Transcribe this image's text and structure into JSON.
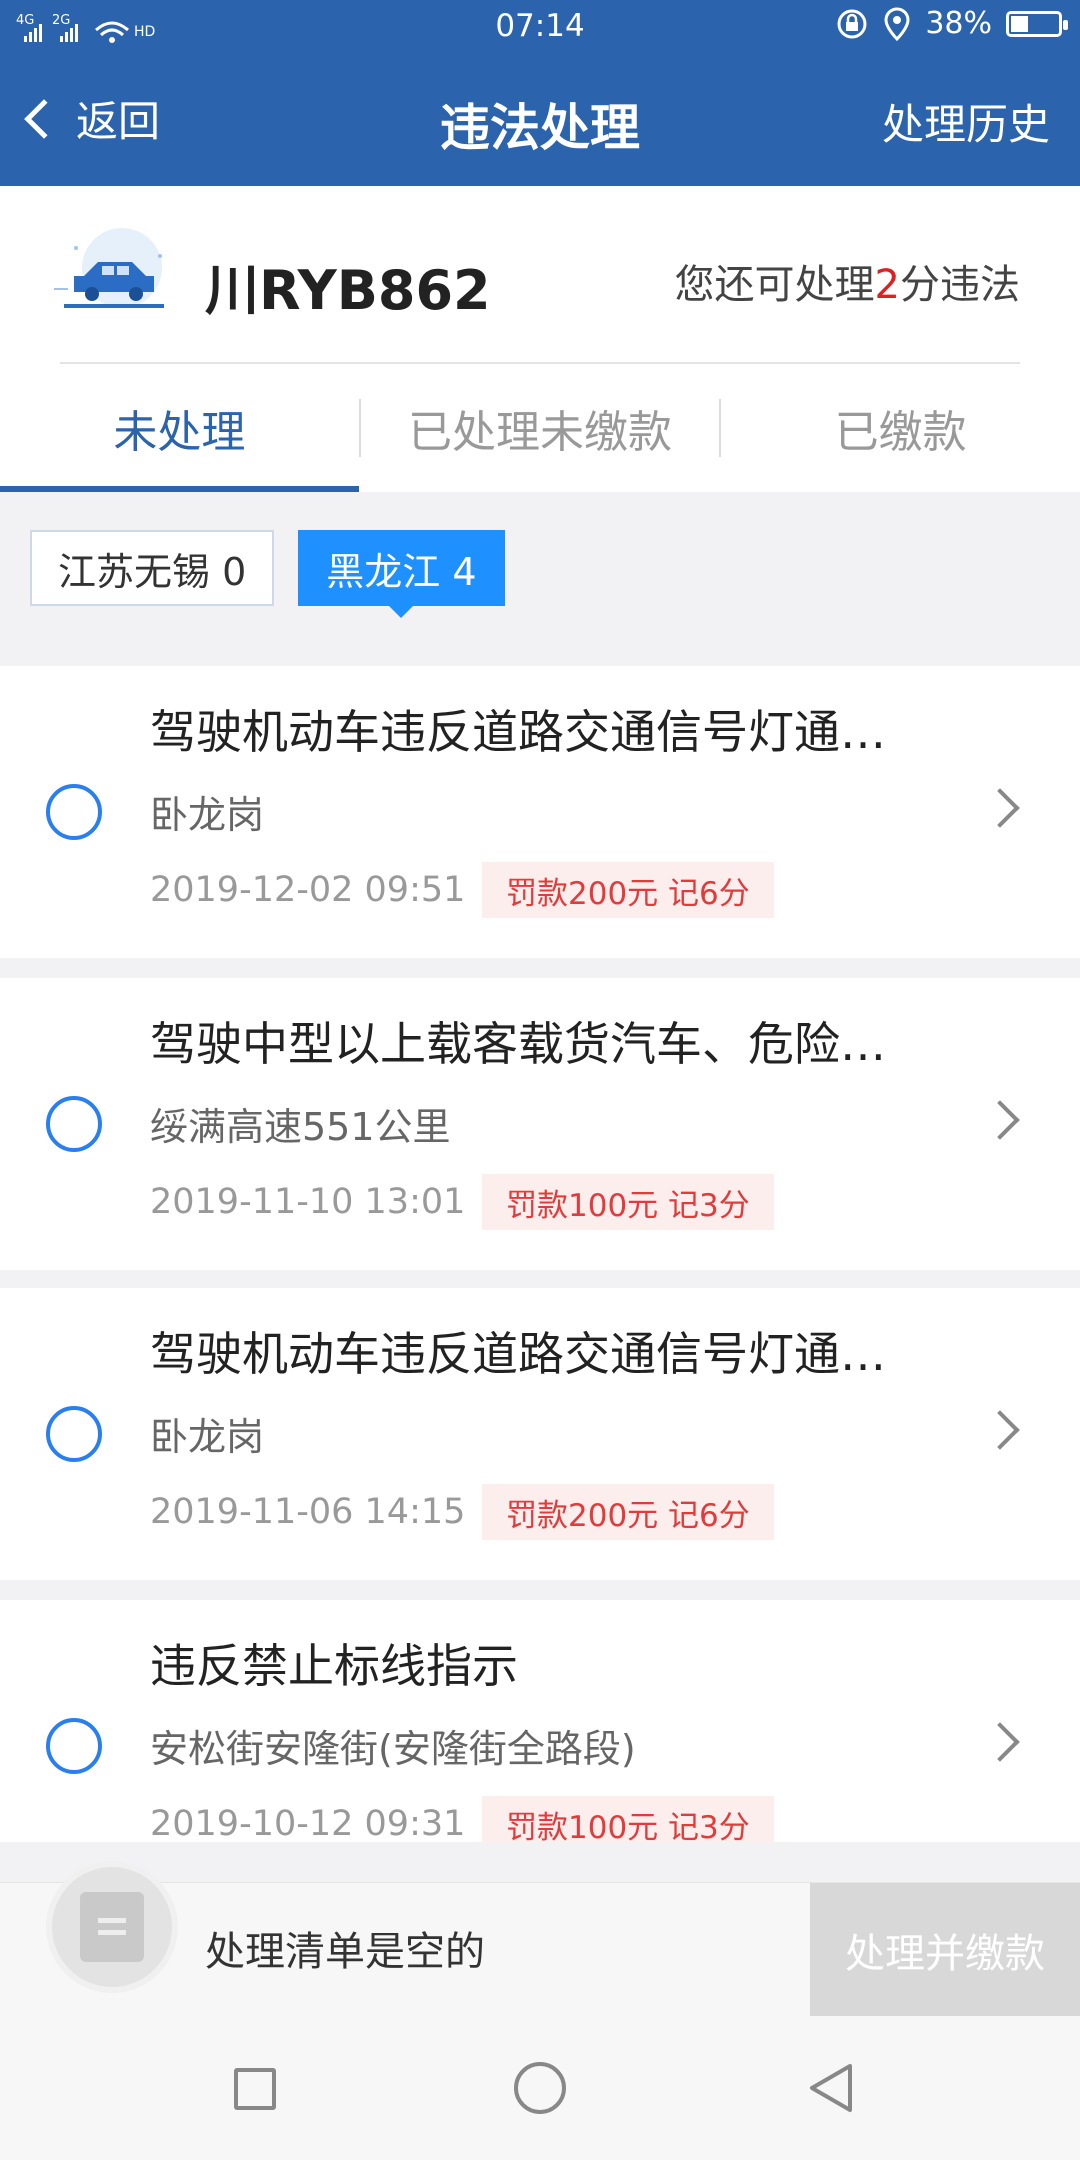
{
  "status_bar": {
    "network": "4G  2G",
    "time": "07:14",
    "battery": "38%",
    "battery_level": 0.38
  },
  "header_bar": {
    "back_label": "返回",
    "title": "违法处理",
    "history_label": "处理历史"
  },
  "vehicle": {
    "plate": "川RYB862",
    "remain_prefix": "您还可处理",
    "remain_points": "2",
    "remain_suffix": "分违法"
  },
  "tabs": [
    {
      "label": "未处理",
      "active": true
    },
    {
      "label": "已处理未缴款",
      "active": false
    },
    {
      "label": "已缴款",
      "active": false
    }
  ],
  "regions": [
    {
      "label": "江苏无锡 0",
      "active": false
    },
    {
      "label": "黑龙江 4",
      "active": true
    }
  ],
  "violations": [
    {
      "title": "驾驶机动车违反道路交通信号灯通行的",
      "location": "卧龙岗",
      "datetime": "2019-12-02 09:51",
      "fine": "罚款200元 记6分"
    },
    {
      "title": "驾驶中型以上载客载货汽车、危险物品",
      "location": "绥满高速551公里",
      "datetime": "2019-11-10 13:01",
      "fine": "罚款100元 记3分"
    },
    {
      "title": "驾驶机动车违反道路交通信号灯通行的",
      "location": "卧龙岗",
      "datetime": "2019-11-06 14:15",
      "fine": "罚款200元 记6分"
    },
    {
      "title": "违反禁止标线指示",
      "location": "安松街安隆街(安隆街全路段)",
      "datetime": "2019-10-12 09:31",
      "fine": "罚款100元 记3分"
    }
  ],
  "bottom": {
    "empty_text": "处理清单是空的",
    "pay_button": "处理并缴款"
  },
  "colors": {
    "brand": "#2b63ad",
    "accent": "#1e90ff",
    "alert": "#e02020"
  }
}
